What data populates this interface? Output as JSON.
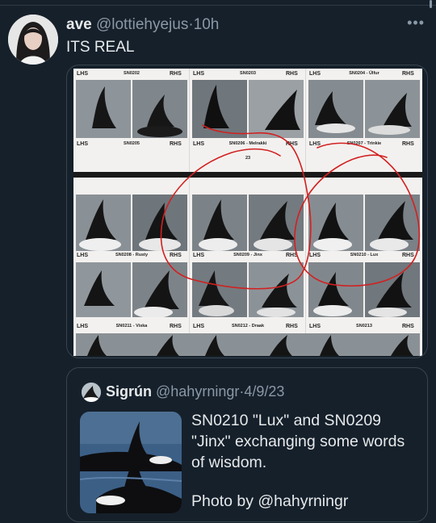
{
  "tweet": {
    "display_name": "ave",
    "handle": "@lottiehyejus",
    "separator": "·",
    "time": "10h",
    "text": "ITS REAL",
    "more_icon": "more-horizontal-icon"
  },
  "sheet": {
    "side_left": "LHS",
    "side_right": "RHS",
    "top_ids": [
      "SN0202",
      "SN0203",
      "SN0204 - Úlfur"
    ],
    "row1_captions": [
      "SN0205",
      "SN0206 - Melrakki",
      "SN0207 - Trinkie"
    ],
    "row1_sub": "23",
    "row2_captions": [
      "SN0208 - Rusty",
      "SN0209 - Jinx",
      "SN0210 - Lux"
    ],
    "row3_captions": [
      "SN0211 - Viska",
      "SN0212 - Draak",
      "SN0213"
    ]
  },
  "quote": {
    "display_name": "Sigrún",
    "handle": "@hahyrningr",
    "separator": "·",
    "date": "4/9/23",
    "text": "SN0210 \"Lux\" and SN0209 \"Jinx\" exchanging some words of wisdom.",
    "credit": "Photo by @hahyrningr"
  },
  "colors": {
    "background": "#15202b",
    "text_primary": "#e7e9ea",
    "text_secondary": "#8b98a5",
    "border": "#38444d",
    "annotation_red": "#d22020"
  }
}
